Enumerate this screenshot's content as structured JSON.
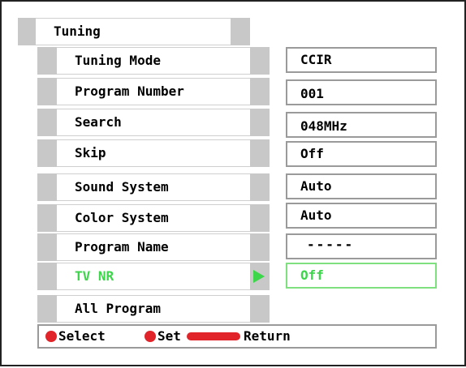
{
  "menu": {
    "title": "Tuning",
    "rows": [
      {
        "label": "Tuning Mode",
        "value": "CCIR"
      },
      {
        "label": "Program Number",
        "value": "001"
      },
      {
        "label": "Search",
        "value": "048MHz"
      },
      {
        "label": "Skip",
        "value": "Off"
      },
      {
        "label": "Sound System",
        "value": "Auto"
      },
      {
        "label": "Color System",
        "value": "Auto"
      },
      {
        "label": "Program Name",
        "value": "-----"
      },
      {
        "label": "TV NR",
        "value": "Off"
      },
      {
        "label": "All Program",
        "value": ""
      }
    ],
    "active_color": "#3cd64a"
  },
  "footer": {
    "select_label": "Select",
    "set_label": "Set",
    "return_label": "Return"
  }
}
